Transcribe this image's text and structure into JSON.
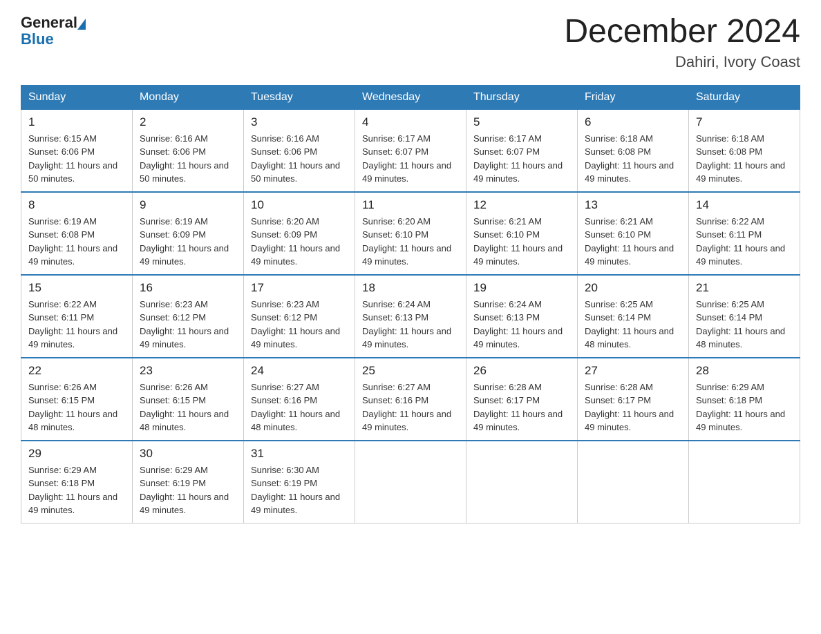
{
  "header": {
    "logo_general": "General",
    "logo_blue": "Blue",
    "month_title": "December 2024",
    "location": "Dahiri, Ivory Coast"
  },
  "weekdays": [
    "Sunday",
    "Monday",
    "Tuesday",
    "Wednesday",
    "Thursday",
    "Friday",
    "Saturday"
  ],
  "weeks": [
    [
      {
        "day": "1",
        "sunrise": "6:15 AM",
        "sunset": "6:06 PM",
        "daylight": "11 hours and 50 minutes."
      },
      {
        "day": "2",
        "sunrise": "6:16 AM",
        "sunset": "6:06 PM",
        "daylight": "11 hours and 50 minutes."
      },
      {
        "day": "3",
        "sunrise": "6:16 AM",
        "sunset": "6:06 PM",
        "daylight": "11 hours and 50 minutes."
      },
      {
        "day": "4",
        "sunrise": "6:17 AM",
        "sunset": "6:07 PM",
        "daylight": "11 hours and 49 minutes."
      },
      {
        "day": "5",
        "sunrise": "6:17 AM",
        "sunset": "6:07 PM",
        "daylight": "11 hours and 49 minutes."
      },
      {
        "day": "6",
        "sunrise": "6:18 AM",
        "sunset": "6:08 PM",
        "daylight": "11 hours and 49 minutes."
      },
      {
        "day": "7",
        "sunrise": "6:18 AM",
        "sunset": "6:08 PM",
        "daylight": "11 hours and 49 minutes."
      }
    ],
    [
      {
        "day": "8",
        "sunrise": "6:19 AM",
        "sunset": "6:08 PM",
        "daylight": "11 hours and 49 minutes."
      },
      {
        "day": "9",
        "sunrise": "6:19 AM",
        "sunset": "6:09 PM",
        "daylight": "11 hours and 49 minutes."
      },
      {
        "day": "10",
        "sunrise": "6:20 AM",
        "sunset": "6:09 PM",
        "daylight": "11 hours and 49 minutes."
      },
      {
        "day": "11",
        "sunrise": "6:20 AM",
        "sunset": "6:10 PM",
        "daylight": "11 hours and 49 minutes."
      },
      {
        "day": "12",
        "sunrise": "6:21 AM",
        "sunset": "6:10 PM",
        "daylight": "11 hours and 49 minutes."
      },
      {
        "day": "13",
        "sunrise": "6:21 AM",
        "sunset": "6:10 PM",
        "daylight": "11 hours and 49 minutes."
      },
      {
        "day": "14",
        "sunrise": "6:22 AM",
        "sunset": "6:11 PM",
        "daylight": "11 hours and 49 minutes."
      }
    ],
    [
      {
        "day": "15",
        "sunrise": "6:22 AM",
        "sunset": "6:11 PM",
        "daylight": "11 hours and 49 minutes."
      },
      {
        "day": "16",
        "sunrise": "6:23 AM",
        "sunset": "6:12 PM",
        "daylight": "11 hours and 49 minutes."
      },
      {
        "day": "17",
        "sunrise": "6:23 AM",
        "sunset": "6:12 PM",
        "daylight": "11 hours and 49 minutes."
      },
      {
        "day": "18",
        "sunrise": "6:24 AM",
        "sunset": "6:13 PM",
        "daylight": "11 hours and 49 minutes."
      },
      {
        "day": "19",
        "sunrise": "6:24 AM",
        "sunset": "6:13 PM",
        "daylight": "11 hours and 49 minutes."
      },
      {
        "day": "20",
        "sunrise": "6:25 AM",
        "sunset": "6:14 PM",
        "daylight": "11 hours and 48 minutes."
      },
      {
        "day": "21",
        "sunrise": "6:25 AM",
        "sunset": "6:14 PM",
        "daylight": "11 hours and 48 minutes."
      }
    ],
    [
      {
        "day": "22",
        "sunrise": "6:26 AM",
        "sunset": "6:15 PM",
        "daylight": "11 hours and 48 minutes."
      },
      {
        "day": "23",
        "sunrise": "6:26 AM",
        "sunset": "6:15 PM",
        "daylight": "11 hours and 48 minutes."
      },
      {
        "day": "24",
        "sunrise": "6:27 AM",
        "sunset": "6:16 PM",
        "daylight": "11 hours and 48 minutes."
      },
      {
        "day": "25",
        "sunrise": "6:27 AM",
        "sunset": "6:16 PM",
        "daylight": "11 hours and 49 minutes."
      },
      {
        "day": "26",
        "sunrise": "6:28 AM",
        "sunset": "6:17 PM",
        "daylight": "11 hours and 49 minutes."
      },
      {
        "day": "27",
        "sunrise": "6:28 AM",
        "sunset": "6:17 PM",
        "daylight": "11 hours and 49 minutes."
      },
      {
        "day": "28",
        "sunrise": "6:29 AM",
        "sunset": "6:18 PM",
        "daylight": "11 hours and 49 minutes."
      }
    ],
    [
      {
        "day": "29",
        "sunrise": "6:29 AM",
        "sunset": "6:18 PM",
        "daylight": "11 hours and 49 minutes."
      },
      {
        "day": "30",
        "sunrise": "6:29 AM",
        "sunset": "6:19 PM",
        "daylight": "11 hours and 49 minutes."
      },
      {
        "day": "31",
        "sunrise": "6:30 AM",
        "sunset": "6:19 PM",
        "daylight": "11 hours and 49 minutes."
      },
      null,
      null,
      null,
      null
    ]
  ]
}
